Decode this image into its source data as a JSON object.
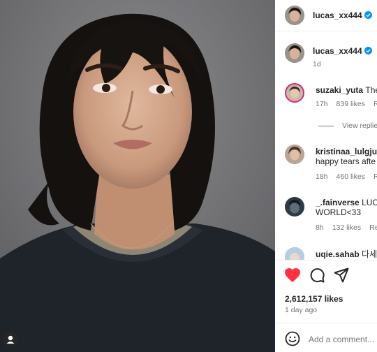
{
  "header": {
    "username": "lucas_xx444"
  },
  "caption": {
    "username": "lucas_xx444",
    "time": "1d"
  },
  "comments": [
    {
      "username": "suzaki_yuta",
      "text": "The",
      "time": "17h",
      "likes": "839 likes",
      "reply": "Re"
    },
    {
      "view_replies": "View replie"
    },
    {
      "username": "kristinaa_lulgjur",
      "text": "happy tears afte",
      "time": "18h",
      "likes": "460 likes",
      "reply": "Re"
    },
    {
      "username": "_.fainverse",
      "text": "LUCA",
      "line2": "WORLD<33",
      "time": "8h",
      "likes": "132 likes",
      "reply": "Rep"
    },
    {
      "username": "uqie.sahab",
      "text": "다세"
    }
  ],
  "actions": {
    "likes": "2,612,157 likes",
    "date": "1 day ago"
  },
  "add_comment": {
    "placeholder": "Add a comment..."
  },
  "colors": {
    "heart": "#ff3040",
    "verified": "#0095f6"
  }
}
